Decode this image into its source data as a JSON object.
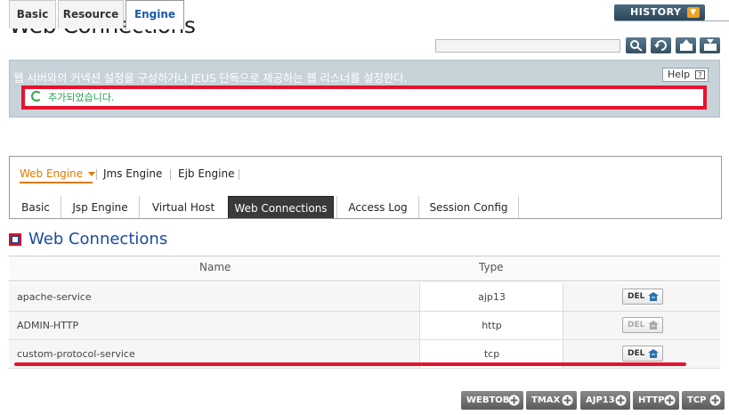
{
  "header": {
    "title": "Web Connections",
    "history_label": "HISTORY",
    "search_placeholder": ""
  },
  "toolbar": {
    "buttons": [
      {
        "name": "search-button",
        "icon": "search-icon"
      },
      {
        "name": "refresh-button",
        "icon": "refresh-icon"
      },
      {
        "name": "export-xml-button",
        "icon": "xml-export-icon"
      },
      {
        "name": "import-xml-button",
        "icon": "xml-import-icon"
      }
    ]
  },
  "description": {
    "text": "웹 서버와의 커넥션 설정을 구성하거나 JEUS 단독으로 제공하는 웹 리스너를 설정한다.",
    "help_label": "Help",
    "message": "추가되었습니다."
  },
  "main_tabs": [
    {
      "label": "Basic",
      "active": false
    },
    {
      "label": "Resource",
      "active": false
    },
    {
      "label": "Engine",
      "active": true
    }
  ],
  "engine_nav": [
    {
      "label": "Web Engine",
      "active": true
    },
    {
      "label": "Jms Engine",
      "active": false
    },
    {
      "label": "Ejb Engine",
      "active": false
    }
  ],
  "inner_tabs": [
    {
      "label": "Basic",
      "active": false
    },
    {
      "label": "Jsp Engine",
      "active": false
    },
    {
      "label": "Virtual Host",
      "active": false
    },
    {
      "label": "Web Connections",
      "active": true
    },
    {
      "label": "Access Log",
      "active": false
    },
    {
      "label": "Session Config",
      "active": false
    }
  ],
  "section": {
    "title": "Web Connections"
  },
  "table": {
    "headers": [
      "Name",
      "Type"
    ],
    "rows": [
      {
        "name": "apache-service",
        "type": "ajp13",
        "del_label": "DEL",
        "del_enabled": true
      },
      {
        "name": "ADMIN-HTTP",
        "type": "http",
        "del_label": "DEL",
        "del_enabled": false
      },
      {
        "name": "custom-protocol-service",
        "type": "tcp",
        "del_label": "DEL",
        "del_enabled": true
      }
    ]
  },
  "add_buttons": [
    "WEBTOB",
    "TMAX",
    "AJP13",
    "HTTP",
    "TCP"
  ],
  "colors": {
    "highlight": "#e8112d",
    "accent_blue": "#1a4b9c",
    "accent_orange": "#e07a00",
    "success_green": "#22a050"
  }
}
